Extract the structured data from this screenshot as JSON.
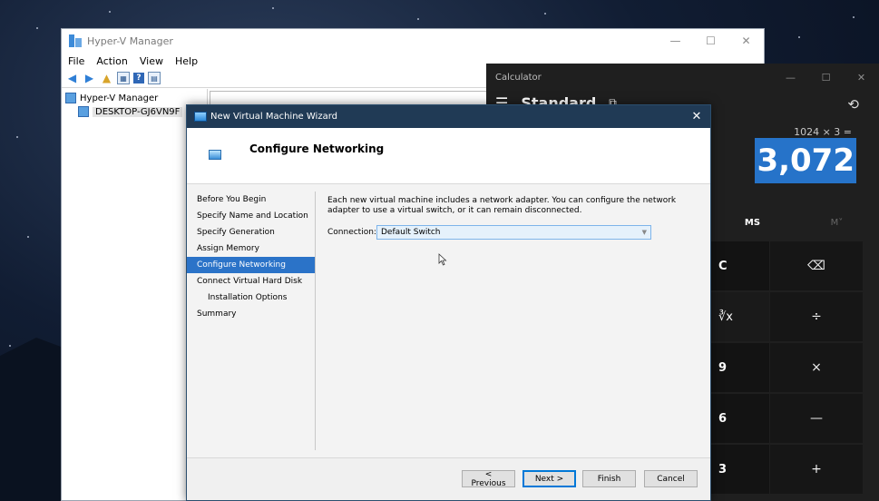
{
  "hyperv": {
    "title": "Hyper-V Manager",
    "window_controls": [
      "—",
      "☐",
      "✕"
    ],
    "menu": [
      "File",
      "Action",
      "View",
      "Help"
    ],
    "tree": {
      "root": "Hyper-V Manager",
      "node": "DESKTOP-GJ6VN9F"
    }
  },
  "calculator": {
    "title": "Calculator",
    "window_controls": [
      "—",
      "☐",
      "✕"
    ],
    "mode": "Standard",
    "expression": "1024 × 3 =",
    "result": "3,072",
    "memory": [
      "MS",
      "M˅"
    ],
    "keys": [
      {
        "left": "C",
        "right": "⌫"
      },
      {
        "left": "∛x",
        "right": "÷"
      },
      {
        "left": "9",
        "right": "×"
      },
      {
        "left": "6",
        "right": "—"
      },
      {
        "left": "3",
        "right": "+"
      }
    ]
  },
  "wizard": {
    "title": "New Virtual Machine Wizard",
    "heading": "Configure Networking",
    "nav": [
      {
        "label": "Before You Begin"
      },
      {
        "label": "Specify Name and Location"
      },
      {
        "label": "Specify Generation"
      },
      {
        "label": "Assign Memory"
      },
      {
        "label": "Configure Networking"
      },
      {
        "label": "Connect Virtual Hard Disk"
      },
      {
        "label": "Installation Options"
      },
      {
        "label": "Summary"
      }
    ],
    "description": "Each new virtual machine includes a network adapter. You can configure the network adapter to use a virtual switch, or it can remain disconnected.",
    "connection_label": "Connection:",
    "connection_value": "Default Switch",
    "buttons": {
      "previous": "< Previous",
      "next": "Next >",
      "finish": "Finish",
      "cancel": "Cancel"
    }
  },
  "accent_color": "#2b73c8"
}
